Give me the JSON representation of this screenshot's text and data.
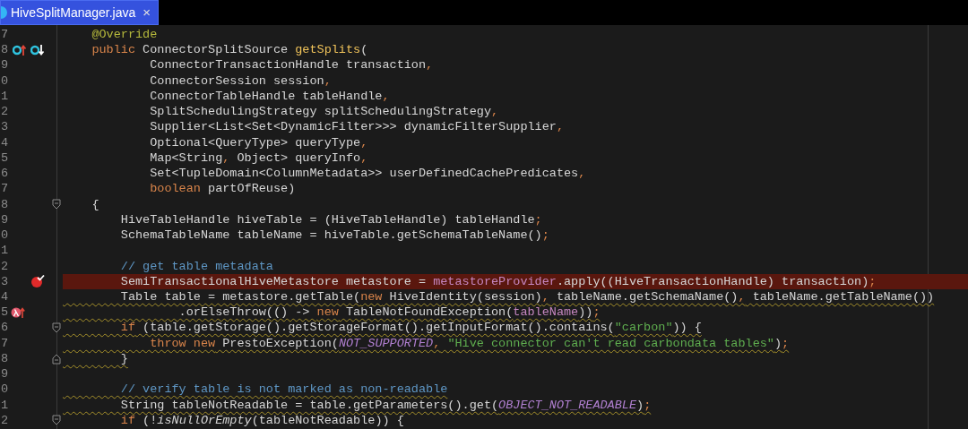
{
  "tab": {
    "title": "HiveSplitManager.java",
    "close": "×",
    "selected": true
  },
  "editor": {
    "lines": [
      {
        "number": "7",
        "highlighted": false,
        "warning": false,
        "tokens": [
          {
            "text": "    @Override",
            "kind": "annotation"
          }
        ]
      },
      {
        "number": "8",
        "highlighted": false,
        "warning": false,
        "gutter_icons": [
          {
            "kind": "overrides"
          },
          {
            "kind": "implemented"
          }
        ],
        "tokens": [
          {
            "text": "    public",
            "kind": "keyword"
          },
          {
            "text": " ConnectorSplitSource ",
            "kind": "plain"
          },
          {
            "text": "getSplits",
            "kind": "method"
          },
          {
            "text": "(",
            "kind": "plain"
          }
        ]
      },
      {
        "number": "9",
        "highlighted": false,
        "warning": false,
        "tokens": [
          {
            "text": "            ConnectorTransactionHandle transaction",
            "kind": "plain"
          },
          {
            "text": ",",
            "kind": "punct"
          }
        ]
      },
      {
        "number": "0",
        "highlighted": false,
        "warning": false,
        "tokens": [
          {
            "text": "            ConnectorSession session",
            "kind": "plain"
          },
          {
            "text": ",",
            "kind": "punct"
          }
        ]
      },
      {
        "number": "1",
        "highlighted": false,
        "warning": false,
        "tokens": [
          {
            "text": "            ConnectorTableHandle tableHandle",
            "kind": "plain"
          },
          {
            "text": ",",
            "kind": "punct"
          }
        ]
      },
      {
        "number": "2",
        "highlighted": false,
        "warning": false,
        "tokens": [
          {
            "text": "            SplitSchedulingStrategy splitSchedulingStrategy",
            "kind": "plain"
          },
          {
            "text": ",",
            "kind": "punct"
          }
        ]
      },
      {
        "number": "3",
        "highlighted": false,
        "warning": false,
        "tokens": [
          {
            "text": "            Supplier<List<Set<DynamicFilter>>> dynamicFilterSupplier",
            "kind": "plain"
          },
          {
            "text": ",",
            "kind": "punct"
          }
        ]
      },
      {
        "number": "4",
        "highlighted": false,
        "warning": false,
        "tokens": [
          {
            "text": "            Optional<QueryType> queryType",
            "kind": "plain"
          },
          {
            "text": ",",
            "kind": "punct"
          }
        ]
      },
      {
        "number": "5",
        "highlighted": false,
        "warning": false,
        "tokens": [
          {
            "text": "            Map<String",
            "kind": "plain"
          },
          {
            "text": ",",
            "kind": "punct"
          },
          {
            "text": " Object> queryInfo",
            "kind": "plain"
          },
          {
            "text": ",",
            "kind": "punct"
          }
        ]
      },
      {
        "number": "6",
        "highlighted": false,
        "warning": false,
        "tokens": [
          {
            "text": "            Set<TupleDomain<ColumnMetadata>> userDefinedCachePredicates",
            "kind": "plain"
          },
          {
            "text": ",",
            "kind": "punct"
          }
        ]
      },
      {
        "number": "7",
        "highlighted": false,
        "warning": false,
        "tokens": [
          {
            "text": "            boolean",
            "kind": "keyword"
          },
          {
            "text": " partOfReuse)",
            "kind": "plain"
          }
        ]
      },
      {
        "number": "8",
        "highlighted": false,
        "warning": false,
        "fold": {
          "kind": "start"
        },
        "tokens": [
          {
            "text": "    {",
            "kind": "plain"
          }
        ]
      },
      {
        "number": "9",
        "highlighted": false,
        "warning": false,
        "tokens": [
          {
            "text": "        HiveTableHandle hiveTable = (HiveTableHandle) tableHandle",
            "kind": "plain"
          },
          {
            "text": ";",
            "kind": "punct"
          }
        ]
      },
      {
        "number": "0",
        "highlighted": false,
        "warning": false,
        "tokens": [
          {
            "text": "        SchemaTableName tableName = hiveTable.getSchemaTableName()",
            "kind": "plain"
          },
          {
            "text": ";",
            "kind": "punct"
          }
        ]
      },
      {
        "number": "1",
        "highlighted": false,
        "warning": false
      },
      {
        "number": "2",
        "highlighted": false,
        "warning": false,
        "tokens": [
          {
            "text": "        // get table metadata",
            "kind": "comment"
          }
        ]
      },
      {
        "number": "3",
        "highlighted": true,
        "warning": false,
        "gutter_icons": [
          {
            "kind": "breakpoint"
          }
        ],
        "tokens": [
          {
            "text": "        SemiTransactionalHiveMetastore metastore = ",
            "kind": "plain"
          },
          {
            "text": "metastoreProvider",
            "kind": "field"
          },
          {
            "text": ".apply((HiveTransactionHandle) transaction)",
            "kind": "plain"
          },
          {
            "text": ";",
            "kind": "punct"
          }
        ]
      },
      {
        "number": "4",
        "highlighted": false,
        "warning": true,
        "tokens": [
          {
            "text": "        Table table = metastore.getTable(",
            "kind": "plain"
          },
          {
            "text": "new",
            "kind": "keyword"
          },
          {
            "text": " HiveIdentity(session)",
            "kind": "plain"
          },
          {
            "text": ",",
            "kind": "punct"
          },
          {
            "text": " tableName.getSchemaName()",
            "kind": "plain"
          },
          {
            "text": ",",
            "kind": "punct"
          },
          {
            "text": " tableName.getTableName())",
            "kind": "plain"
          }
        ]
      },
      {
        "number": "5",
        "highlighted": false,
        "warning": true,
        "gutter_icons": [
          {
            "kind": "lambda_breakpoint"
          }
        ],
        "tokens": [
          {
            "text": "                .orElseThrow(() -> ",
            "kind": "plain"
          },
          {
            "text": "new",
            "kind": "keyword"
          },
          {
            "text": " TableNotFoundException(",
            "kind": "plain"
          },
          {
            "text": "tableName",
            "kind": "field"
          },
          {
            "text": "))",
            "kind": "plain"
          },
          {
            "text": ";",
            "kind": "punct"
          }
        ]
      },
      {
        "number": "6",
        "highlighted": false,
        "warning": true,
        "fold": {
          "kind": "start"
        },
        "tokens": [
          {
            "text": "        if",
            "kind": "keyword"
          },
          {
            "text": " (table.getStorage().getStorageFormat().getInputFormat().contains(",
            "kind": "plain"
          },
          {
            "text": "\"carbon\"",
            "kind": "string"
          },
          {
            "text": ")) {",
            "kind": "plain"
          }
        ]
      },
      {
        "number": "7",
        "highlighted": false,
        "warning": true,
        "tokens": [
          {
            "text": "            throw new",
            "kind": "keyword"
          },
          {
            "text": " PrestoException(",
            "kind": "plain"
          },
          {
            "text": "NOT_SUPPORTED",
            "kind": "constant"
          },
          {
            "text": ",",
            "kind": "punct"
          },
          {
            "text": " \"Hive connector can't read carbondata tables\"",
            "kind": "string"
          },
          {
            "text": ")",
            "kind": "plain"
          },
          {
            "text": ";",
            "kind": "punct"
          }
        ]
      },
      {
        "number": "8",
        "highlighted": false,
        "warning": true,
        "fold": {
          "kind": "end"
        },
        "tokens": [
          {
            "text": "        }",
            "kind": "plain"
          }
        ]
      },
      {
        "number": "9",
        "highlighted": false,
        "warning": false
      },
      {
        "number": "0",
        "highlighted": false,
        "warning": true,
        "tokens": [
          {
            "text": "        // verify table is not marked as non-readable",
            "kind": "comment"
          }
        ]
      },
      {
        "number": "1",
        "highlighted": false,
        "warning": true,
        "tokens": [
          {
            "text": "        String tableNotReadable = table.getParameters().get(",
            "kind": "plain"
          },
          {
            "text": "OBJECT_NOT_READABLE",
            "kind": "constant"
          },
          {
            "text": ")",
            "kind": "plain"
          },
          {
            "text": ";",
            "kind": "punct"
          }
        ]
      },
      {
        "number": "2",
        "highlighted": false,
        "warning": false,
        "fold": {
          "kind": "start"
        },
        "tokens": [
          {
            "text": "        if",
            "kind": "keyword"
          },
          {
            "text": " (!",
            "kind": "plain"
          },
          {
            "text": "isNullOrEmpty",
            "kind": "static_call"
          },
          {
            "text": "(tableNotReadable)) {",
            "kind": "plain"
          }
        ]
      }
    ]
  }
}
